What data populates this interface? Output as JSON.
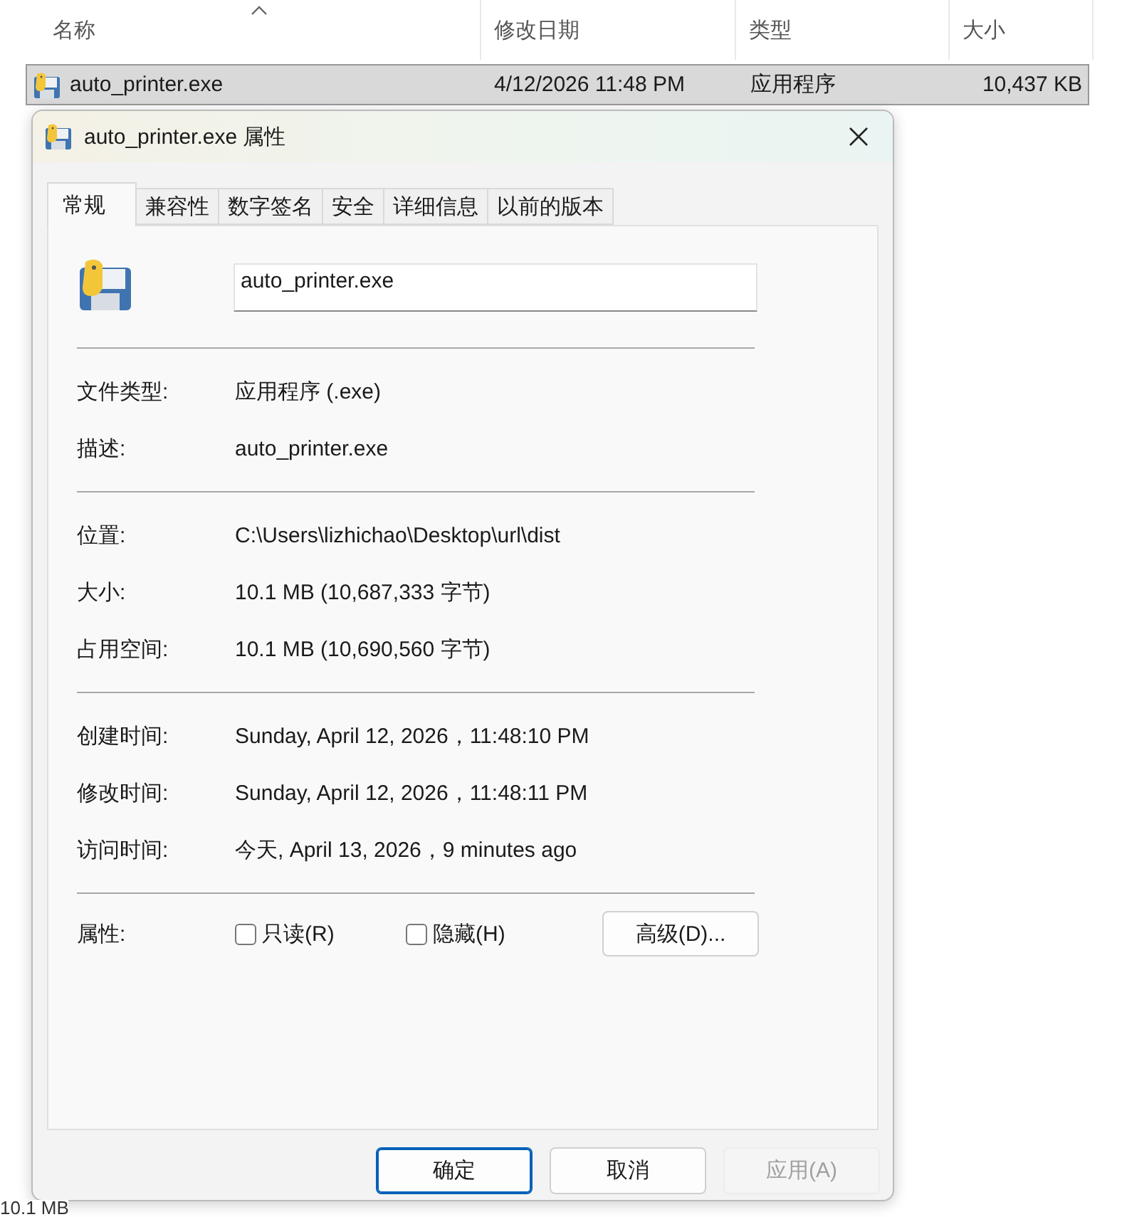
{
  "explorer": {
    "columns": [
      {
        "label": "名称",
        "sorted": true
      },
      {
        "label": "修改日期",
        "sorted": false
      },
      {
        "label": "类型",
        "sorted": false
      },
      {
        "label": "大小",
        "sorted": false
      }
    ],
    "files": [
      {
        "name": "auto_printer.exe",
        "date": "4/12/2026 11:48 PM",
        "type": "应用程序",
        "size": "10,437 KB",
        "selected": true
      }
    ],
    "status_bar": "10.1 MB"
  },
  "dialog": {
    "title": "auto_printer.exe 属性",
    "tabs": [
      {
        "label": "常规",
        "selected": true
      },
      {
        "label": "兼容性",
        "selected": false
      },
      {
        "label": "数字签名",
        "selected": false
      },
      {
        "label": "安全",
        "selected": false
      },
      {
        "label": "详细信息",
        "selected": false
      },
      {
        "label": "以前的版本",
        "selected": false
      }
    ],
    "name_field": {
      "value": "auto_printer.exe"
    },
    "sections": [
      [
        {
          "label": "文件类型:",
          "value": "应用程序 (.exe)"
        },
        {
          "label": "描述:",
          "value": "auto_printer.exe"
        }
      ],
      [
        {
          "label": "位置:",
          "value": "C:\\Users\\lizhichao\\Desktop\\url\\dist"
        },
        {
          "label": "大小:",
          "value": "10.1 MB (10,687,333 字节)"
        },
        {
          "label": "占用空间:",
          "value": "10.1 MB (10,690,560 字节)"
        }
      ],
      [
        {
          "label": "创建时间:",
          "value": "Sunday, April 12, 2026，11:48:10 PM"
        },
        {
          "label": "修改时间:",
          "value": "Sunday, April 12, 2026，11:48:11 PM"
        },
        {
          "label": "访问时间:",
          "value": "今天, April 13, 2026，9 minutes ago"
        }
      ]
    ],
    "attributes": {
      "label": "属性:",
      "checkboxes": [
        {
          "label": "只读(R)",
          "checked": false
        },
        {
          "label": "隐藏(H)",
          "checked": false
        }
      ],
      "advanced_button": "高级(D)..."
    },
    "buttons": [
      {
        "label": "确定",
        "kind": "default",
        "disabled": false
      },
      {
        "label": "取消",
        "kind": "normal",
        "disabled": false
      },
      {
        "label": "应用(A)",
        "kind": "normal",
        "disabled": true
      }
    ]
  }
}
